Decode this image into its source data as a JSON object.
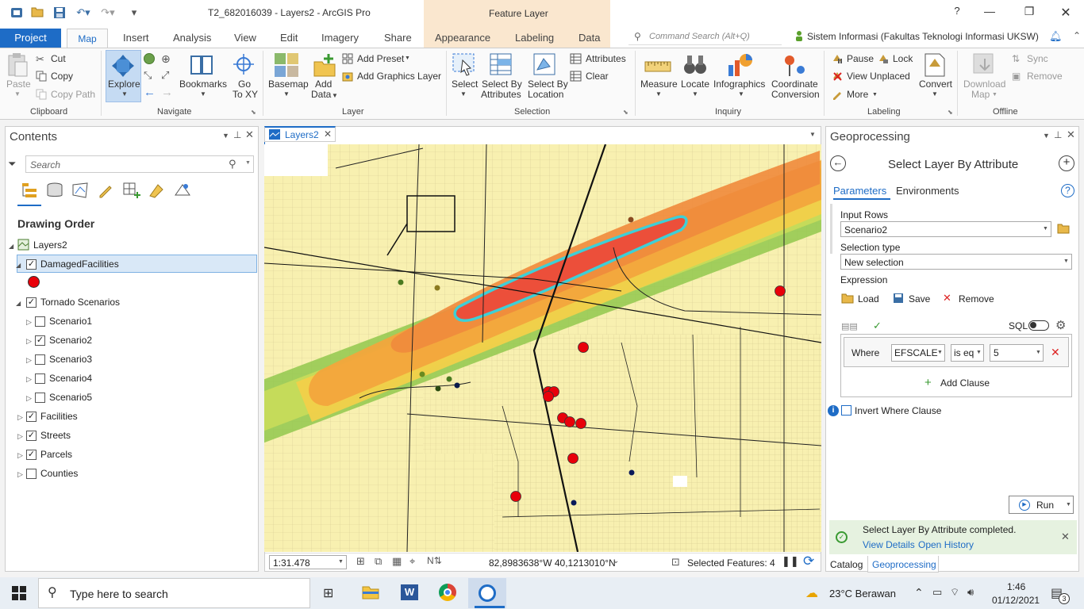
{
  "title_bar": {
    "document_title": "T2_682016039 - Layers2 - ArcGIS Pro",
    "contextual_tab_header": "Feature Layer",
    "help": "?"
  },
  "tabs": {
    "project": "Project",
    "items": [
      "Map",
      "Insert",
      "Analysis",
      "View",
      "Edit",
      "Imagery",
      "Share",
      "Appearance",
      "Labeling",
      "Data"
    ],
    "command_search_placeholder": "Command Search (Alt+Q)",
    "user_label": "Sistem Informasi (Fakultas Teknologi Informasi UKSW)"
  },
  "ribbon": {
    "clipboard": {
      "paste": "Paste",
      "cut": "Cut",
      "copy": "Copy",
      "copy_path": "Copy Path",
      "group": "Clipboard"
    },
    "navigate": {
      "explore": "Explore",
      "bookmarks": "Bookmarks",
      "go_to_xy_1": "Go",
      "go_to_xy_2": "To XY",
      "group": "Navigate"
    },
    "layer": {
      "basemap": "Basemap",
      "add_data_1": "Add",
      "add_data_2": "Data",
      "add_preset": "Add Preset",
      "add_graphics_layer": "Add Graphics Layer",
      "group": "Layer"
    },
    "selection": {
      "select": "Select",
      "select_by_attributes_1": "Select By",
      "select_by_attributes_2": "Attributes",
      "select_by_location_1": "Select By",
      "select_by_location_2": "Location",
      "attributes": "Attributes",
      "clear": "Clear",
      "group": "Selection"
    },
    "inquiry": {
      "measure": "Measure",
      "locate": "Locate",
      "infographics": "Infographics",
      "coord_conv_1": "Coordinate",
      "coord_conv_2": "Conversion",
      "group": "Inquiry"
    },
    "labeling": {
      "pause": "Pause",
      "lock": "Lock",
      "view_unplaced": "View Unplaced",
      "more": "More",
      "convert": "Convert",
      "group": "Labeling"
    },
    "offline": {
      "download_map_1": "Download",
      "download_map_2": "Map",
      "sync": "Sync",
      "remove": "Remove",
      "group": "Offline"
    }
  },
  "contents": {
    "title": "Contents",
    "search_placeholder": "Search",
    "drawing_order": "Drawing Order",
    "map_name": "Layers2",
    "layers": [
      {
        "name": "DamagedFacilities",
        "checked": true
      },
      {
        "name": "Tornado Scenarios",
        "checked": true
      },
      {
        "name": "Scenario1",
        "checked": false
      },
      {
        "name": "Scenario2",
        "checked": true
      },
      {
        "name": "Scenario3",
        "checked": false
      },
      {
        "name": "Scenario4",
        "checked": false
      },
      {
        "name": "Scenario5",
        "checked": false
      },
      {
        "name": "Facilities",
        "checked": true
      },
      {
        "name": "Streets",
        "checked": true
      },
      {
        "name": "Parcels",
        "checked": true
      },
      {
        "name": "Counties",
        "checked": false
      }
    ],
    "check_mark": "✓"
  },
  "map_view": {
    "tab_title": "Layers2",
    "scale": "1:31.478",
    "coordinates": "82,8983638°W 40,1213010°N",
    "selected_features": "Selected Features: 4"
  },
  "geoprocessing": {
    "panel_title": "Geoprocessing",
    "tool_title": "Select Layer By Attribute",
    "tab_parameters": "Parameters",
    "tab_environments": "Environments",
    "input_rows_label": "Input Rows",
    "input_rows_value": "Scenario2",
    "selection_type_label": "Selection type",
    "selection_type_value": "New selection",
    "expression_label": "Expression",
    "load": "Load",
    "save": "Save",
    "remove": "Remove",
    "sql": "SQL",
    "where": "Where",
    "field": "EFSCALE",
    "operator": "is eq",
    "value": "5",
    "add_clause": "Add Clause",
    "invert_where": "Invert Where Clause",
    "run": "Run",
    "status_message": "Select Layer By Attribute completed.",
    "view_details": "View Details",
    "open_history": "Open History",
    "bottom_tab_catalog": "Catalog",
    "bottom_tab_geoprocessing": "Geoprocessing"
  },
  "taskbar": {
    "search_placeholder": "Type here to search",
    "weather": "23°C  Berawan",
    "time": "1:46",
    "date": "01/12/2021",
    "notification_count": "3"
  },
  "colors": {
    "accent": "#1e6cc6",
    "contextual": "#fae7cf",
    "damaged_facility": "#e8000a",
    "parcel_fill": "#f8f0b0",
    "selection_outline": "#3ecfd6"
  }
}
